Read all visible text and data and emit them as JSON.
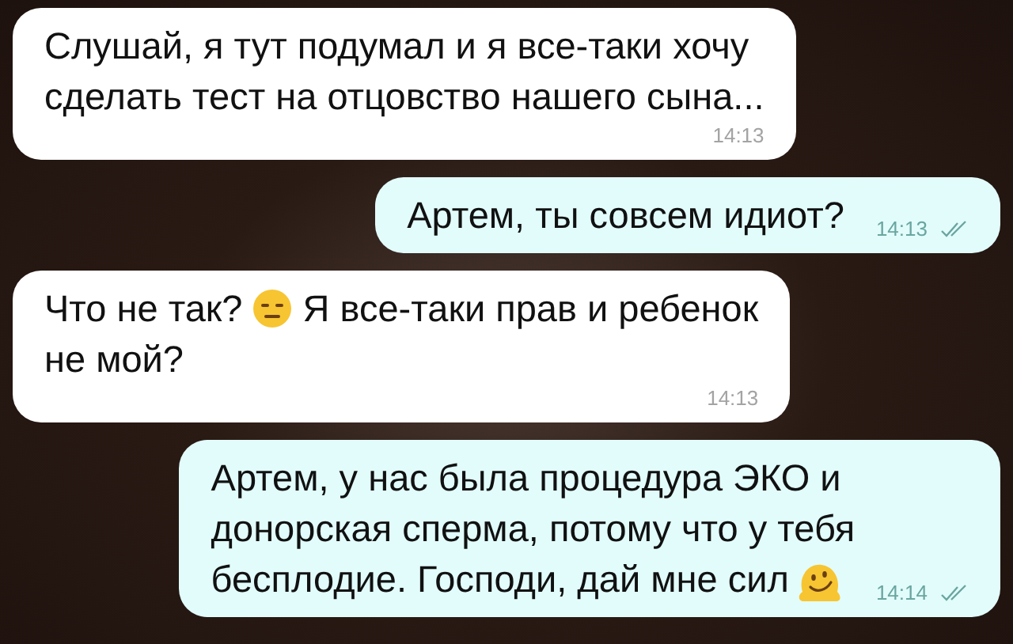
{
  "messages": [
    {
      "outgoing": false,
      "read": false,
      "lines": [
        [
          {
            "kind": "text",
            "text": "Слушай, я тут подумал и я все-таки хочу"
          }
        ],
        [
          {
            "kind": "text",
            "text": "сделать тест на отцовство нашего сына..."
          }
        ]
      ],
      "time": "14:13"
    },
    {
      "outgoing": true,
      "read": true,
      "lines": [
        [
          {
            "kind": "text",
            "text": "Артем, ты совсем идиот?"
          }
        ]
      ],
      "time": "14:13"
    },
    {
      "outgoing": false,
      "read": false,
      "lines": [
        [
          {
            "kind": "text",
            "text": "Что не так?"
          },
          {
            "kind": "expressionless"
          },
          {
            "kind": "text",
            "text": "Я все-таки прав и ребенок"
          }
        ],
        [
          {
            "kind": "text",
            "text": "не мой?"
          }
        ]
      ],
      "time": "14:13"
    },
    {
      "outgoing": true,
      "read": true,
      "lines": [
        [
          {
            "kind": "text",
            "text": "Артем, у нас была процедура ЭКО и"
          }
        ],
        [
          {
            "kind": "text",
            "text": "донорская сперма, потому что у тебя"
          }
        ],
        [
          {
            "kind": "text",
            "text": "бесплодие. Господи, дай мне сил"
          },
          {
            "kind": "melting"
          }
        ]
      ],
      "time": "14:14"
    }
  ]
}
